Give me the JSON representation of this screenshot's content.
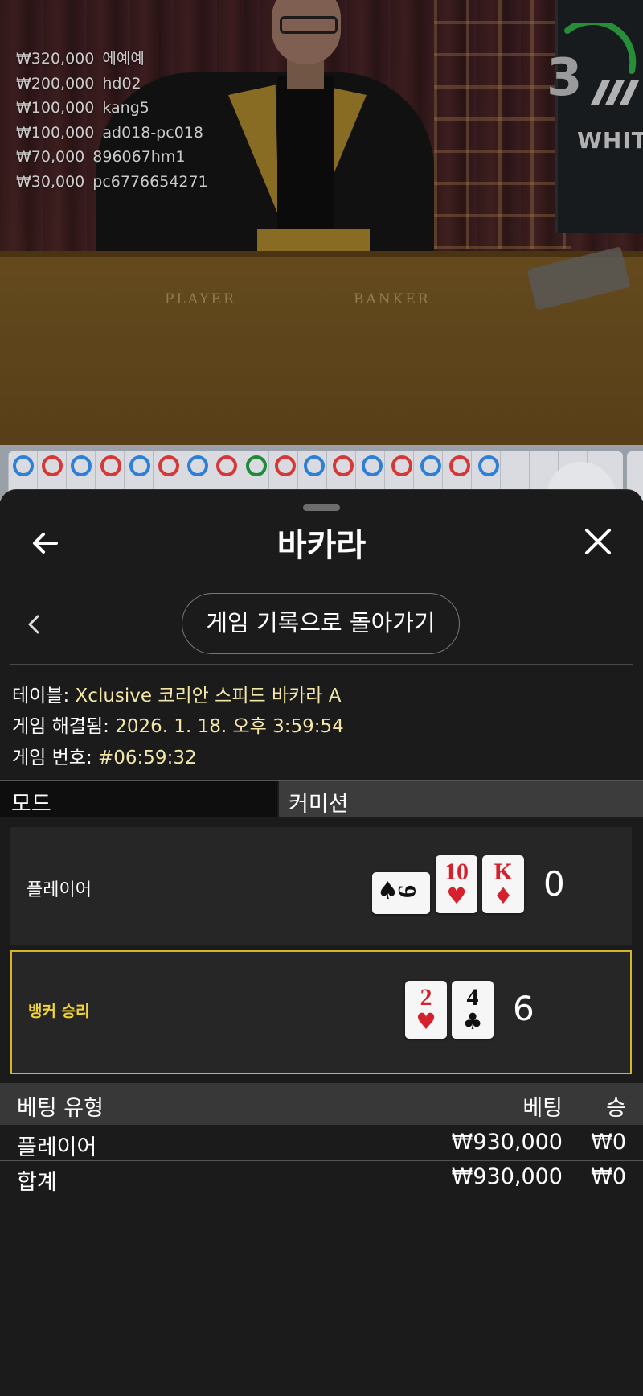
{
  "live": {
    "timer": "3",
    "brand": "WHITE",
    "felt_labels": {
      "player": "PLAYER",
      "banker": "BANKER"
    },
    "winners": [
      {
        "amount": "₩320,000",
        "user": "에예예"
      },
      {
        "amount": "₩200,000",
        "user": "hd02"
      },
      {
        "amount": "₩100,000",
        "user": "kang5"
      },
      {
        "amount": "₩100,000",
        "user": "ad018-pc018"
      },
      {
        "amount": "₩70,000",
        "user": "896067hm1"
      },
      {
        "amount": "₩30,000",
        "user": "pc6776654271"
      }
    ]
  },
  "bead_road": {
    "top_row": [
      "P",
      "B",
      "P",
      "B",
      "P",
      "B",
      "P",
      "B",
      "T",
      "B",
      "P",
      "B",
      "P",
      "B",
      "P",
      "B",
      "P"
    ],
    "colors": {
      "banker": "#d63838",
      "player": "#2f7fd6",
      "tie": "#1e8a3a"
    }
  },
  "sheet": {
    "title": "바카라",
    "back_icon": "arrow-left-icon",
    "close_icon": "close-icon",
    "history_button": "게임 기록으로 돌아가기",
    "info": {
      "table_label": "테이블:",
      "table_value": "Xclusive 코리안 스피드 바카라 A",
      "resolved_label": "게임 해결됨:",
      "resolved_value": "2026. 1. 18. 오후 3:59:54",
      "number_label": "게임 번호:",
      "number_value": "#06:59:32"
    },
    "mode": {
      "left": "모드",
      "right": "커미션"
    },
    "player": {
      "label": "플레이어",
      "score": "0",
      "cards": [
        {
          "rank": "9",
          "suit": "♠",
          "color": "black",
          "sideways": true
        },
        {
          "rank": "10",
          "suit": "♥",
          "color": "red"
        },
        {
          "rank": "K",
          "suit": "♦",
          "color": "red"
        }
      ]
    },
    "banker": {
      "label": "뱅커 승리",
      "score": "6",
      "cards": [
        {
          "rank": "2",
          "suit": "♥",
          "color": "red"
        },
        {
          "rank": "4",
          "suit": "♣",
          "color": "black"
        }
      ]
    },
    "bets": {
      "headers": {
        "type": "베팅 유형",
        "bet": "베팅",
        "win": "승"
      },
      "rows": [
        {
          "type": "플레이어",
          "bet": "₩930,000",
          "win": "₩0"
        }
      ],
      "total": {
        "type": "합계",
        "bet": "₩930,000",
        "win": "₩0"
      }
    }
  }
}
